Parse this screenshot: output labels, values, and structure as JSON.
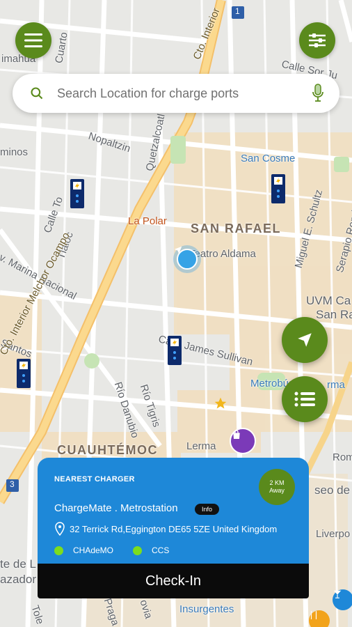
{
  "colors": {
    "accent_green": "#5a8a1c",
    "card_blue": "#1e88d8",
    "checkin_black": "#0b0b0b",
    "type_dot": "#7cdd1e",
    "charger_pin": "#0d2a6b"
  },
  "top_bar": {
    "menu_icon": "hamburger-icon",
    "filter_icon": "sliders-icon"
  },
  "search": {
    "placeholder": "Search Location for charge ports",
    "value": "",
    "left_icon": "search-icon",
    "right_icon": "microphone-icon"
  },
  "map_labels": {
    "cto_interior_top": "Cto. Interior",
    "cto_interior_bottom": "Cto. Interior Melchor Ocampo",
    "calle_sor": "Calle Sor Ju",
    "imahua": "imahua",
    "cuarto": "Cuarto",
    "nopaltzin": "Nopaltzin",
    "quetzalcoatl": "Quetzalcoatl",
    "minos": "minos",
    "san_cosme": "San Cosme",
    "la_polar": "La Polar",
    "san_rafael": "SAN RAFAEL",
    "teatro": "Teatro Aldama",
    "marina": "v. Marina Nacional",
    "tlaloc": "Tlaloc",
    "calle_to": "Calle To",
    "miguel": "Miguel E. Schultz",
    "serapio": "Serapio Rendon",
    "uvm": "UVM Ca",
    "uvm2": "San Ra",
    "santos": "Santos",
    "james": "Calle James Sullivan",
    "metrobus": "Metrobús",
    "rma": "rma",
    "rio_danubio": "Río Danubio",
    "rio_tigris": "Río Tigris",
    "cuauhtemoc": "CUAUHTÉMOC",
    "lerma": "Lerma",
    "rom": "Rom",
    "paseo": "seo de",
    "liverpool": "Liverpo",
    "te_de_l": "te de L",
    "azador": "azador",
    "insurgentes": "Insurgentes",
    "praga": "Praga",
    "varsovia": "ovia",
    "toledo": "Tole",
    "route_1": "1",
    "route_3": "3"
  },
  "fabs": {
    "locate_icon": "navigation-arrow-icon",
    "list_icon": "list-icon"
  },
  "nearest_card": {
    "heading": "NEAREST CHARGER",
    "distance_value": "2 KM",
    "distance_label": "Away",
    "station_name": "ChargeMate . Metrostation",
    "info_label": "Info",
    "address": "32 Terrick Rd,Eggington  DE65 5ZE United Kingdom",
    "connector_types": [
      "CHAdeMO",
      "CCS"
    ]
  },
  "checkin": {
    "label": "Check-In"
  }
}
